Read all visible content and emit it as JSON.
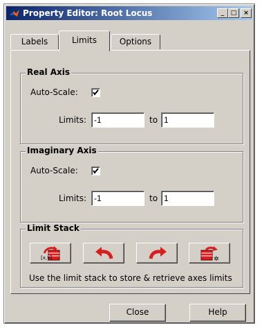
{
  "window": {
    "title": "Property Editor: Root Locus"
  },
  "tabs": [
    {
      "label": "Labels",
      "active": false
    },
    {
      "label": "Limits",
      "active": true
    },
    {
      "label": "Options",
      "active": false
    }
  ],
  "real_axis": {
    "title": "Real Axis",
    "autoscale_label": "Auto-Scale:",
    "autoscale_checked": true,
    "limits_label": "Limits:",
    "min": "-1",
    "to_label": "to",
    "max": "1"
  },
  "imaginary_axis": {
    "title": "Imaginary Axis",
    "autoscale_label": "Auto-Scale:",
    "autoscale_checked": true,
    "limits_label": "Limits:",
    "min": "-1",
    "to_label": "to",
    "max": "1"
  },
  "limit_stack": {
    "title": "Limit Stack",
    "xy_icon_text": "[x,y]",
    "buttons": [
      "stack-push-icon",
      "undo-arrow-icon",
      "redo-arrow-icon",
      "stack-clear-icon"
    ],
    "hint": "Use the limit stack to store & retrieve axes limits"
  },
  "footer": {
    "close_label": "Close",
    "help_label": "Help"
  },
  "colors": {
    "dialog": "#d4d0c8",
    "title_start": "#0a246a",
    "title_end": "#a6caf0",
    "icon_red": "#d42020"
  }
}
